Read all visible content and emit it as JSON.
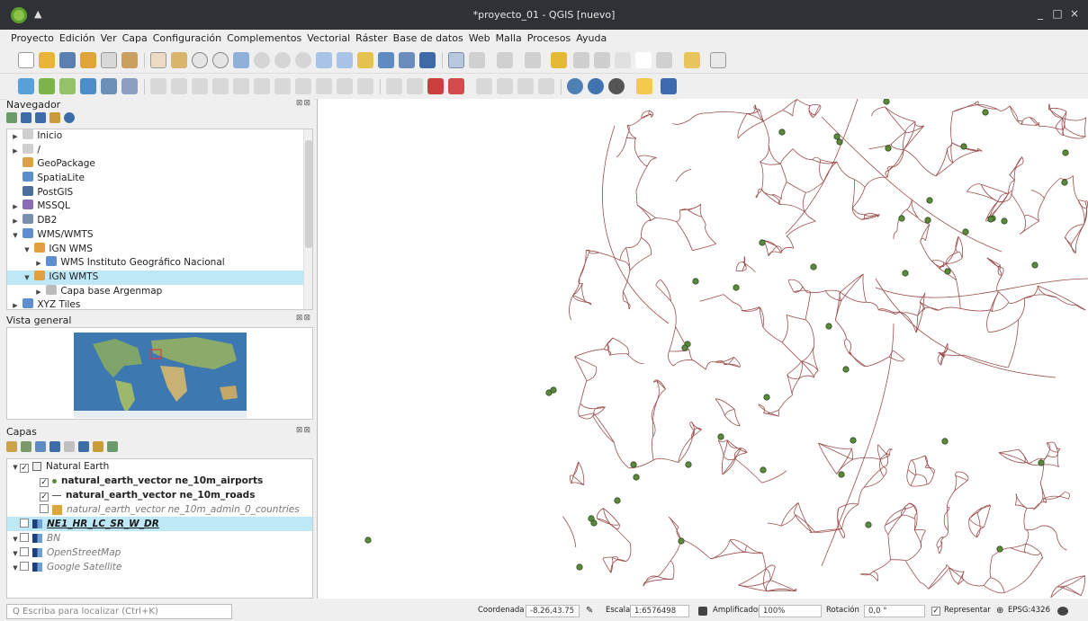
{
  "window": {
    "title": "*proyecto_01 - QGIS [nuevo]",
    "up_glyph": "▲",
    "min_glyph": "_",
    "max_glyph": "□",
    "close_glyph": "×"
  },
  "menu": [
    "Proyecto",
    "Edición",
    "Ver",
    "Capa",
    "Configuración",
    "Complementos",
    "Vectorial",
    "Ráster",
    "Base de datos",
    "Web",
    "Malla",
    "Procesos",
    "Ayuda"
  ],
  "navigator": {
    "title": "Navegador",
    "close_label": "⊠⊠",
    "items": [
      {
        "label": "Inicio",
        "arrow": "▶",
        "indent": 0,
        "icon": "home-folder-icon",
        "color": "#cfcfcf"
      },
      {
        "label": "/",
        "arrow": "▶",
        "indent": 0,
        "icon": "folder-icon",
        "color": "#cfcfcf"
      },
      {
        "label": "GeoPackage",
        "arrow": "",
        "indent": 0,
        "icon": "geopackage-icon",
        "color": "#d9a24a"
      },
      {
        "label": "SpatiaLite",
        "arrow": "",
        "indent": 0,
        "icon": "spatialite-icon",
        "color": "#5b8fc9"
      },
      {
        "label": "PostGIS",
        "arrow": "",
        "indent": 0,
        "icon": "postgis-icon",
        "color": "#4c6e9c"
      },
      {
        "label": "MSSQL",
        "arrow": "▶",
        "indent": 0,
        "icon": "mssql-icon",
        "color": "#8a6bb5"
      },
      {
        "label": "DB2",
        "arrow": "▶",
        "indent": 0,
        "icon": "db2-icon",
        "color": "#7a8fb0"
      },
      {
        "label": "WMS/WMTS",
        "arrow": "▼",
        "indent": 0,
        "icon": "globe-icon",
        "color": "#5f8ed0"
      },
      {
        "label": "IGN WMS",
        "arrow": "▼",
        "indent": 1,
        "icon": "wms-connection-icon",
        "color": "#e0a040"
      },
      {
        "label": "WMS Instituto Geográfico Nacional",
        "arrow": "▶",
        "indent": 2,
        "icon": "globe-icon",
        "color": "#5f8ed0"
      },
      {
        "label": "IGN WMTS",
        "arrow": "▼",
        "indent": 1,
        "icon": "wmts-connection-icon",
        "color": "#e0a040",
        "selected": true
      },
      {
        "label": "Capa base Argenmap",
        "arrow": "▶",
        "indent": 2,
        "icon": "layer-group-icon",
        "color": "#bbbbbb"
      },
      {
        "label": "XYZ Tiles",
        "arrow": "▶",
        "indent": 0,
        "icon": "globe-icon",
        "color": "#5f8ed0"
      }
    ]
  },
  "overview": {
    "title": "Vista general",
    "close_label": "⊠⊠"
  },
  "layers": {
    "title": "Capas",
    "close_label": "⊠⊠",
    "items": [
      {
        "label": "Natural Earth",
        "arrow": "▼",
        "indent": 0,
        "checked": true,
        "style": "",
        "sym": "group"
      },
      {
        "label": "natural_earth_vector ne_10m_airports",
        "arrow": "",
        "indent": 1,
        "checked": true,
        "style": "bold",
        "sym": "point"
      },
      {
        "label": "natural_earth_vector ne_10m_roads",
        "arrow": "",
        "indent": 1,
        "checked": true,
        "style": "bold",
        "sym": "line"
      },
      {
        "label": "natural_earth_vector ne_10m_admin_0_countries",
        "arrow": "",
        "indent": 1,
        "checked": false,
        "style": "it",
        "sym": "polygon"
      },
      {
        "label": "NE1_HR_LC_SR_W_DR",
        "arrow": "",
        "indent": 0,
        "checked": false,
        "style": "it bold-u",
        "sym": "raster",
        "selected": true
      },
      {
        "label": "BN",
        "arrow": "▼",
        "indent": 0,
        "checked": false,
        "style": "it",
        "sym": "raster"
      },
      {
        "label": "OpenStreetMap",
        "arrow": "▼",
        "indent": 0,
        "checked": false,
        "style": "it",
        "sym": "raster"
      },
      {
        "label": "Google Satellite",
        "arrow": "▼",
        "indent": 0,
        "checked": false,
        "style": "it",
        "sym": "raster"
      }
    ]
  },
  "status": {
    "search_placeholder": "Q  Escriba para localizar (Ctrl+K)",
    "coord_label": "Coordenada",
    "coord_value": "-8.26,43.75",
    "scale_label": "Escala",
    "scale_value": "1:6576498",
    "magnifier_label": "Amplificador",
    "magnifier_value": "100%",
    "rotation_label": "Rotación",
    "rotation_value": "0,0 °",
    "render_label": "Representar",
    "crs_label": "EPSG:4326"
  },
  "colors": {
    "roads": "#8a2e2e",
    "airports": "#5c8a3c",
    "airport_stroke": "#2d4a1e"
  }
}
